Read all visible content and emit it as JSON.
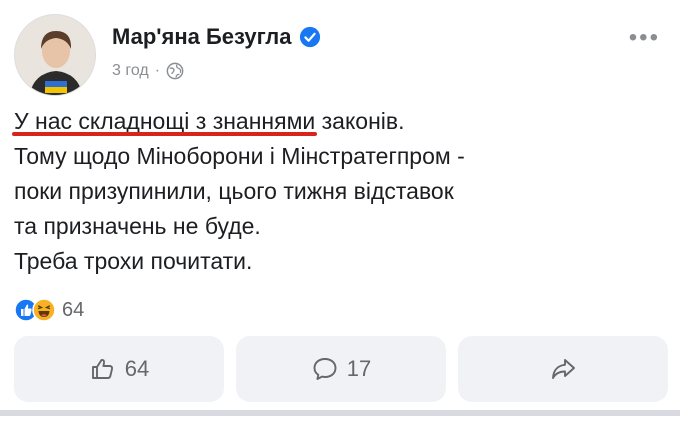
{
  "post": {
    "author": "Мар'яна Безугла",
    "timestamp": "3 год",
    "separator": "·",
    "text_underlined": "У нас складнощі з знаннями",
    "text_line1_rest": " законів.",
    "text_lines": [
      "Тому щодо Міноборони і Мінстратегпром -",
      "поки призупинили, цього тижня відставок",
      "та призначень не буде.",
      "Треба трохи почитати."
    ]
  },
  "reactions": {
    "count": "64",
    "icons": [
      "like-icon",
      "haha-icon"
    ]
  },
  "actions": {
    "like_count": "64",
    "comment_count": "17"
  },
  "colors": {
    "underline": "#d9241b",
    "verified": "#1877f2",
    "button_bg": "#f0f2f5"
  }
}
